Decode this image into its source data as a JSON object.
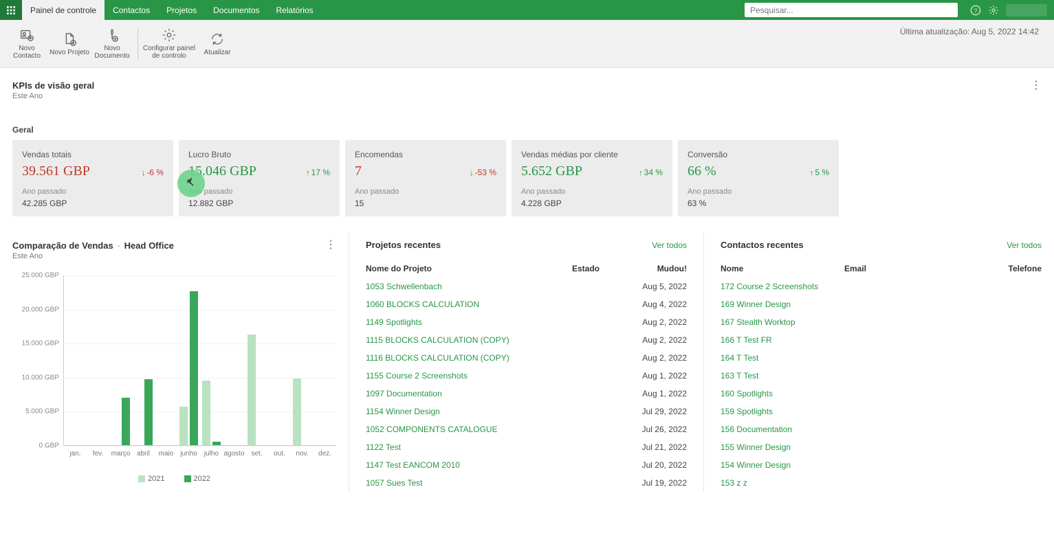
{
  "top": {
    "tabs": [
      "Painel de controle",
      "Contactos",
      "Projetos",
      "Documentos",
      "Relatórios"
    ],
    "search_placeholder": "Pesquisar..."
  },
  "toolbar": {
    "new_contact": "Novo Contacto",
    "new_project": "Novo Projeto",
    "new_document": "Novo Documento",
    "configure": "Configurar painel de controlo",
    "refresh": "Atualizar",
    "last_update": "Última atualização: Aug 5, 2022 14:42"
  },
  "kpi_section": {
    "title": "KPIs de visão geral",
    "period": "Este Ano",
    "group": "Geral",
    "cards": [
      {
        "title": "Vendas totais",
        "value": "39.561 GBP",
        "tone": "red",
        "delta": "-6 %",
        "dir": "down",
        "prev_label": "Ano passado",
        "prev": "42.285 GBP"
      },
      {
        "title": "Lucro Bruto",
        "value": "15.046 GBP",
        "tone": "green",
        "delta": "17 %",
        "dir": "up",
        "prev_label": "Ano passado",
        "prev": "12.882 GBP"
      },
      {
        "title": "Encomendas",
        "value": "7",
        "tone": "red",
        "delta": "-53 %",
        "dir": "down",
        "prev_label": "Ano passado",
        "prev": "15"
      },
      {
        "title": "Vendas médias por cliente",
        "value": "5.652 GBP",
        "tone": "green",
        "delta": "34 %",
        "dir": "up",
        "prev_label": "Ano passado",
        "prev": "4.228 GBP"
      },
      {
        "title": "Conversão",
        "value": "66 %",
        "tone": "green",
        "delta": "5 %",
        "dir": "up",
        "prev_label": "Ano passado",
        "prev": "63 %"
      }
    ]
  },
  "sales_panel": {
    "title": "Comparação de Vendas",
    "scope": "Head Office",
    "period": "Este Ano"
  },
  "projects_panel": {
    "title": "Projetos recentes",
    "see_all": "Ver todos",
    "col_name": "Nome do Projeto",
    "col_state": "Estado",
    "col_date": "Mudou!",
    "rows": [
      {
        "name": "1053 Schwellenbach",
        "date": "Aug 5, 2022"
      },
      {
        "name": "1060 BLOCKS CALCULATION",
        "date": "Aug 4, 2022"
      },
      {
        "name": "1149 Spotlights",
        "date": "Aug 2, 2022"
      },
      {
        "name": "1115 BLOCKS CALCULATION (COPY)",
        "date": "Aug 2, 2022"
      },
      {
        "name": "1116 BLOCKS CALCULATION (COPY)",
        "date": "Aug 2, 2022"
      },
      {
        "name": "1155 Course 2 Screenshots",
        "date": "Aug 1, 2022"
      },
      {
        "name": "1097 Documentation",
        "date": "Aug 1, 2022"
      },
      {
        "name": "1154 Winner Design",
        "date": "Jul 29, 2022"
      },
      {
        "name": "1052 COMPONENTS CATALOGUE",
        "date": "Jul 26, 2022"
      },
      {
        "name": "1122 Test",
        "date": "Jul 21, 2022"
      },
      {
        "name": "1147 Test EANCOM 2010",
        "date": "Jul 20, 2022"
      },
      {
        "name": "1057 Sues Test",
        "date": "Jul 19, 2022"
      }
    ]
  },
  "contacts_panel": {
    "title": "Contactos recentes",
    "see_all": "Ver todos",
    "col_name": "Nome",
    "col_email": "Email",
    "col_phone": "Telefone",
    "rows": [
      {
        "name": "172 Course 2 Screenshots"
      },
      {
        "name": "169 Winner Design"
      },
      {
        "name": "167 Stealth Worktop"
      },
      {
        "name": "166 T Test FR"
      },
      {
        "name": "164 T Test"
      },
      {
        "name": "163 T Test"
      },
      {
        "name": "160 Spotlights"
      },
      {
        "name": "159 Spotlights"
      },
      {
        "name": "156 Documentation"
      },
      {
        "name": "155 Winner Design"
      },
      {
        "name": "154 Winner Design"
      },
      {
        "name": "153 z z"
      }
    ]
  },
  "chart_data": {
    "type": "bar",
    "title": "Comparação de Vendas - Head Office",
    "ylabel": "GBP",
    "ylim": [
      0,
      25000
    ],
    "yticks": [
      0,
      5000,
      10000,
      15000,
      20000,
      25000
    ],
    "ytick_labels": [
      "0 GBP",
      "5.000 GBP",
      "10.000 GBP",
      "15.000 GBP",
      "20.000 GBP",
      "25.000 GBP"
    ],
    "categories": [
      "jan.",
      "fev.",
      "março",
      "abril",
      "maio",
      "junho",
      "julho",
      "agosto",
      "set.",
      "out.",
      "nov.",
      "dez."
    ],
    "series": [
      {
        "name": "2021",
        "color": "#b8e2c0",
        "values": [
          0,
          0,
          0,
          0,
          0,
          5600,
          9500,
          0,
          16200,
          0,
          9800,
          0
        ]
      },
      {
        "name": "2022",
        "color": "#3aa65a",
        "values": [
          0,
          0,
          7000,
          9700,
          0,
          22600,
          500,
          0,
          0,
          0,
          0,
          0
        ]
      }
    ],
    "legend": [
      "2021",
      "2022"
    ]
  }
}
